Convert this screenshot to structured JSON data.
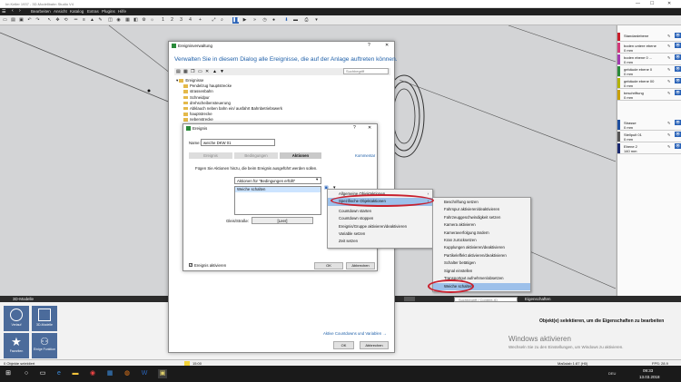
{
  "window": {
    "title": "Im Keller 1937 - 3D-Modellbahn Studio V4"
  },
  "menu": [
    "Bearbeiten",
    "Ansicht",
    "Katalog",
    "Extras",
    "Plugins",
    "Hilfe"
  ],
  "toolbar": {
    "pages": [
      "1",
      "2",
      "3",
      "4"
    ],
    "plus": "+"
  },
  "layers": [
    {
      "name": "Standardebene",
      "size": "",
      "color": "#c81e2b"
    },
    {
      "name": "boden untere ebene",
      "size": "0 mm",
      "color": "#d23a7a"
    },
    {
      "name": "boden ebene 0 ...",
      "size": "0 mm",
      "color": "#a23bb0"
    },
    {
      "name": "gebäude ebene 0",
      "size": "0 mm",
      "color": "#2a8a3a"
    },
    {
      "name": "gebäude ebene 00",
      "size": "0 mm",
      "color": "#b3b300"
    },
    {
      "name": "beschriftung",
      "size": "0 mm",
      "color": "#c8a000"
    },
    {
      "name": "Strasse",
      "size": "0 mm",
      "color": "#1f4f9f"
    },
    {
      "name": "Stellpult 01",
      "size": "0 mm",
      "color": "#555555"
    },
    {
      "name": "Ebene 2",
      "size": "140 mm",
      "color": "#1a2a70"
    }
  ],
  "bottom": {
    "header_left": "3D-Modelle",
    "header_right": "Eigenschaften",
    "search_placeholder": "Suchbegriff / Content-ID",
    "tiles": [
      "Verlauf",
      "3D-Modelle",
      "Favoriten",
      "Einige Funktion"
    ],
    "properties_msg": "Objekt(e) selektieren, um die Eigenschaften zu bearbeiten",
    "activate_title": "Windows aktivieren",
    "activate_sub": "Wechseln Sie zu den Einstellungen, um Windows zu aktivieren."
  },
  "status": {
    "left": "0 Objekte selektiert",
    "mid": "15:00",
    "right1": "Maßstab 1:87 (H0)",
    "right2": "FPS: 28.9"
  },
  "taskbar": {
    "lang": "DEU",
    "time": "09:33",
    "date": "13.03.2018"
  },
  "ev_manager": {
    "title": "Ereignisverwaltung",
    "help": "?",
    "close": "✕",
    "heading": "Verwalten Sie in diesem Dialog alle Ereignisse, die auf der Anlage auftreten können.",
    "search_placeholder": "Suchbegriff",
    "tree": [
      "Ereignisse",
      "Pendelzug hauptstrecke",
      "strassenbahn",
      "Schneidpur",
      "drehscheibensteuerung",
      "Abklauch neben bahn ein/ ausfahrt Bahnbetriebswerk",
      "hauptstrecke",
      "nebenstrecke"
    ],
    "link": "Aktive Countdowns und Variablen →",
    "ok": "OK",
    "cancel": "Abbrechen"
  },
  "event": {
    "title": "Ereignis",
    "help": "?",
    "close": "✕",
    "name_label": "Name:",
    "name_value": "weiche DKW 01",
    "tabs": [
      "Ereignis",
      "Bedingungen",
      "Aktionen"
    ],
    "comment_tab": "Kommentar",
    "desc": "Fügen Sie Aktionen hinzu, die beim Ereignis ausgeführt werden sollen.",
    "dropdown": "Aktionen für \"Bedingungen erfüllt\"",
    "list_item": "Weiche schalten",
    "field_label": "Gleis/Straße:",
    "field_value": "[Leer]",
    "checkbox_label": "Ereignis aktivieren",
    "ok": "OK",
    "cancel": "Abbrechen"
  },
  "menu1": [
    "Allgemeine Objektaktionen",
    "Spezifische Objektaktionen",
    "Countdown starten",
    "Countdown stoppen",
    "Ereignis/Gruppe aktivieren/deaktivieren",
    "Variable setzen",
    "Zeit setzen"
  ],
  "menu2": [
    "Beschriftung setzen",
    "Fahrspur aktivieren/deaktivieren",
    "Fahrzeuggeschwindigkeit setzen",
    "Kamera aktivieren",
    "Kameraverfolgung ändern",
    "Kran zurücksetzen",
    "Kupplungen aktivieren/deaktivieren",
    "Partikeleffekt aktivieren/deaktivieren",
    "Schalter betätigen",
    "Signal einstellen",
    "Transportgut aufnehmen/absetzen",
    "Weiche schalten"
  ]
}
